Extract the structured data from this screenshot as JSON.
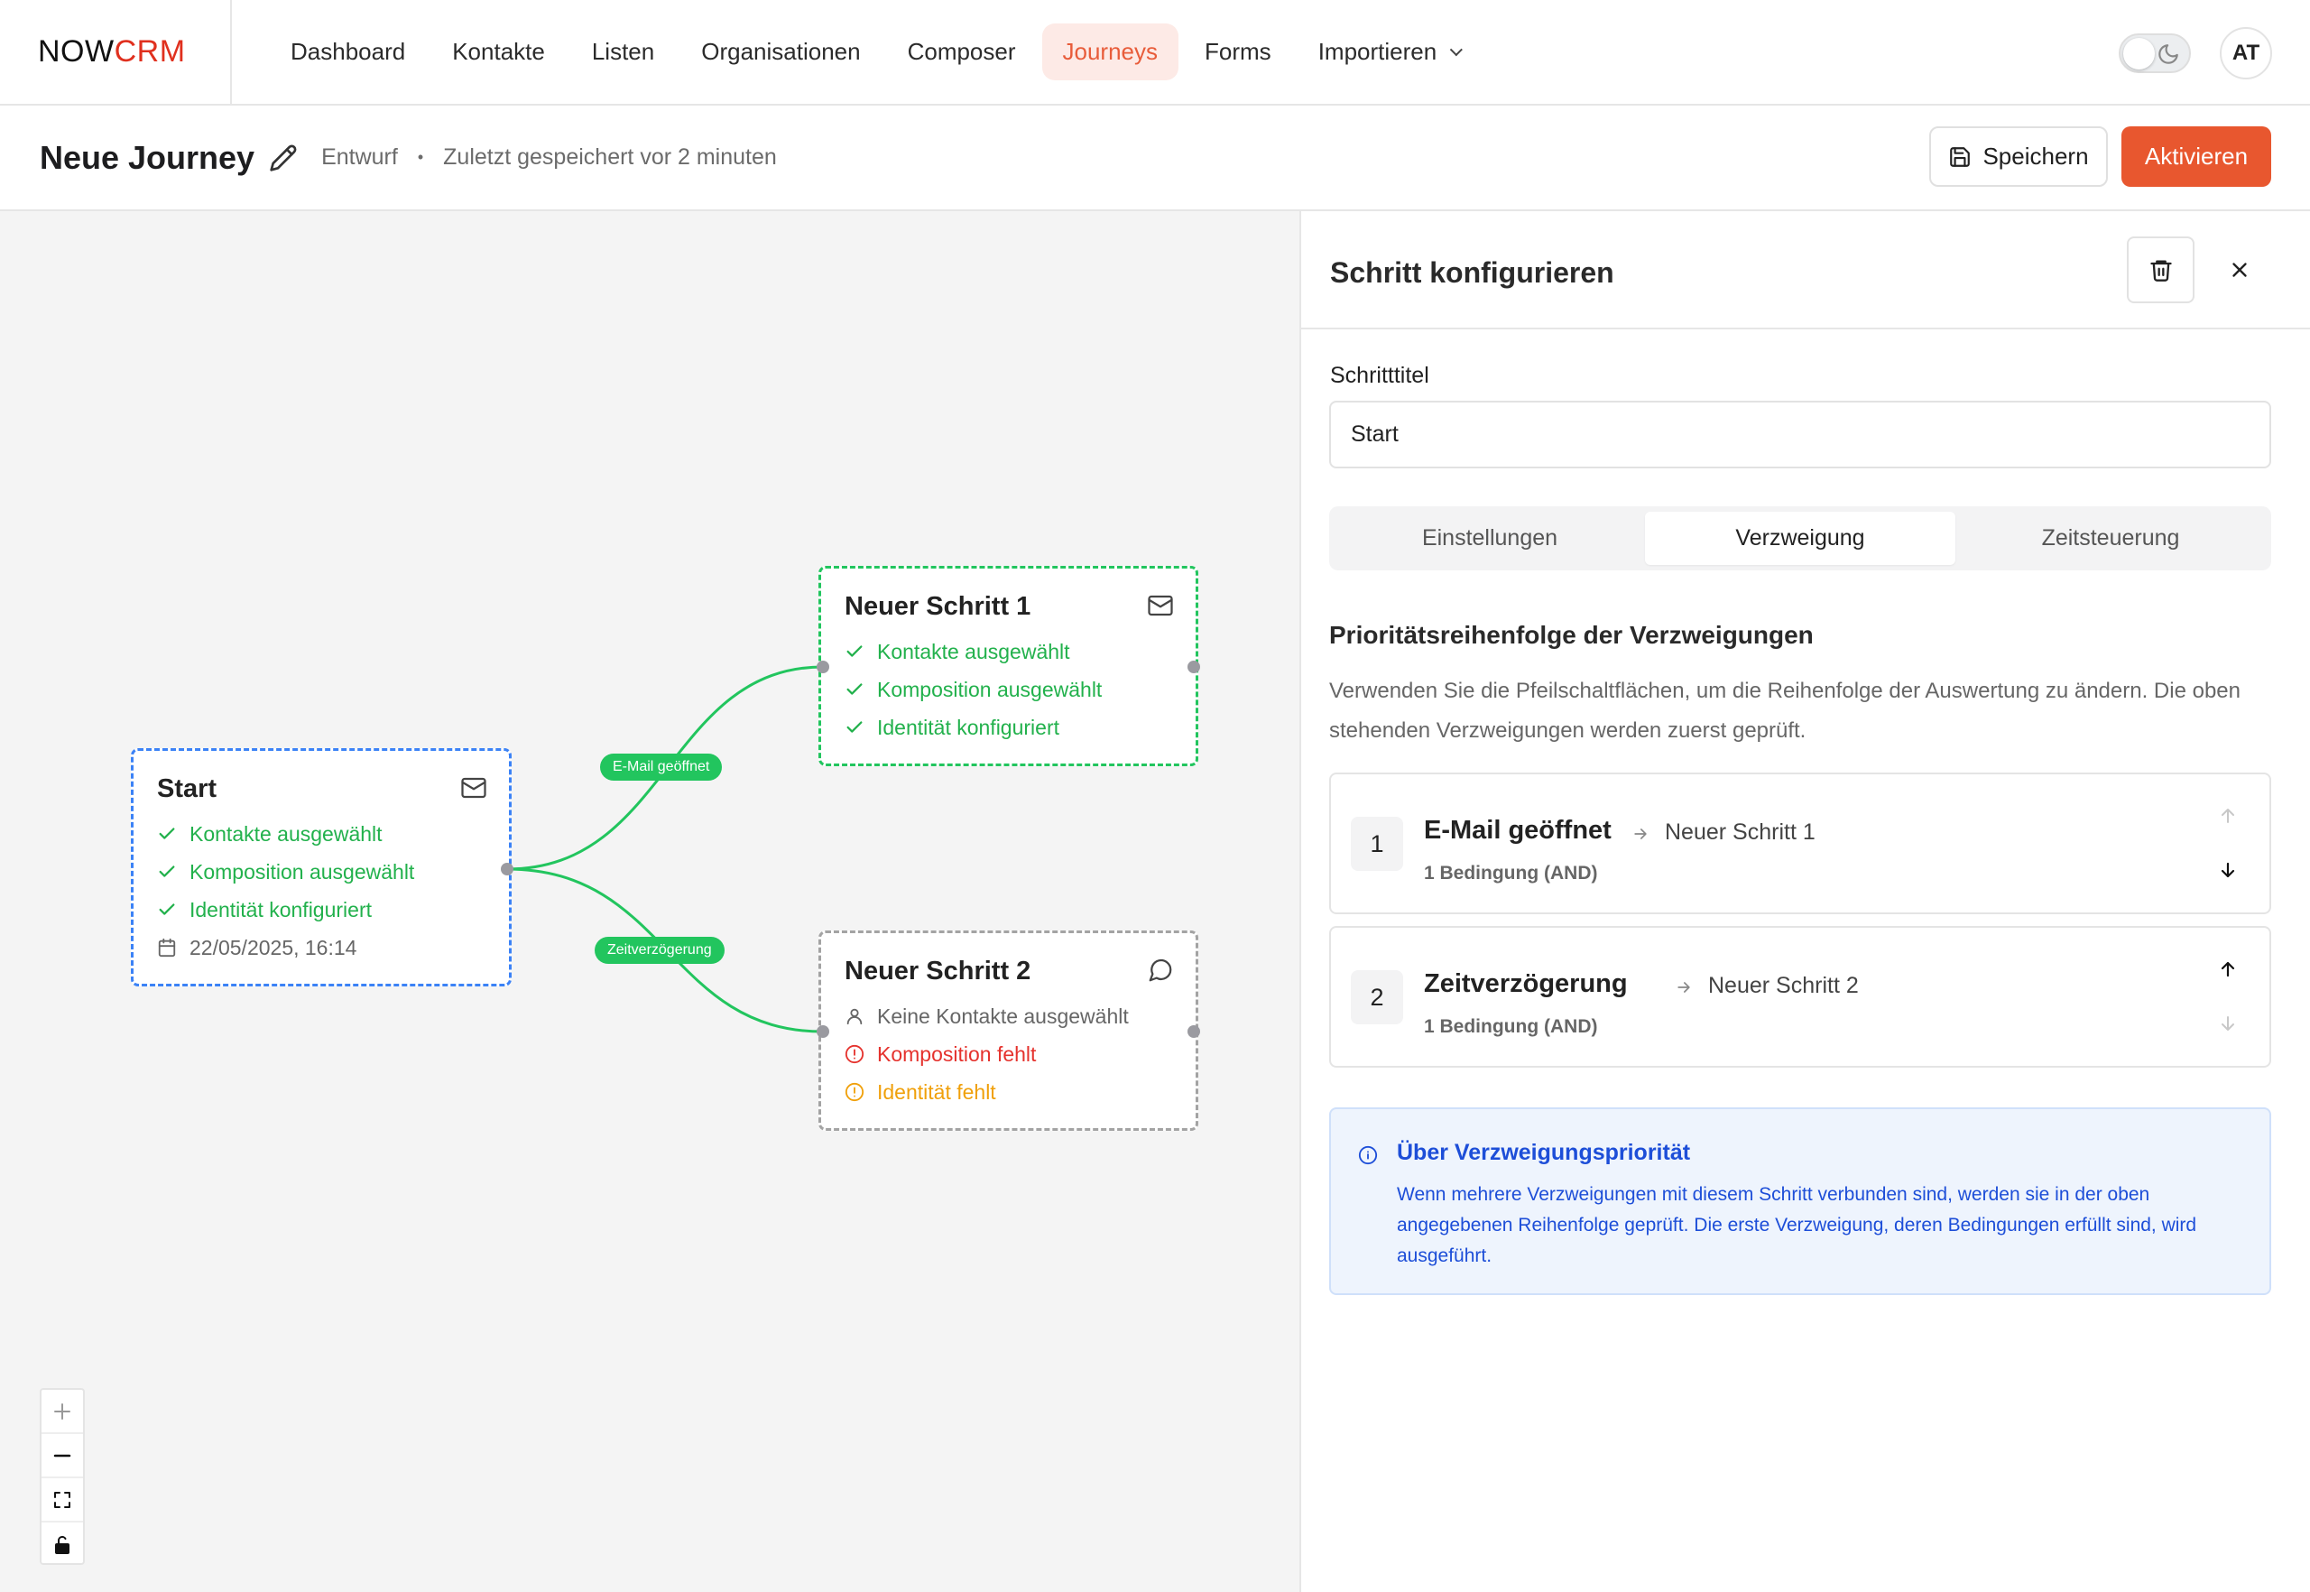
{
  "brand": {
    "part1": "NOW",
    "part2": "CRM"
  },
  "nav": {
    "items": [
      {
        "label": "Dashboard",
        "active": false
      },
      {
        "label": "Kontakte",
        "active": false
      },
      {
        "label": "Listen",
        "active": false
      },
      {
        "label": "Organisationen",
        "active": false
      },
      {
        "label": "Composer",
        "active": false
      },
      {
        "label": "Journeys",
        "active": true
      },
      {
        "label": "Forms",
        "active": false
      },
      {
        "label": "Importieren",
        "active": false,
        "has_dropdown": true
      }
    ],
    "avatar_initials": "AT"
  },
  "journey": {
    "title": "Neue Journey",
    "status": "Entwurf",
    "saved_info": "Zuletzt gespeichert vor 2 minuten",
    "save_label": "Speichern",
    "activate_label": "Aktivieren"
  },
  "canvas": {
    "nodes": {
      "start": {
        "title": "Start",
        "icon": "mail-icon",
        "lines": [
          "Kontakte ausgewählt",
          "Komposition ausgewählt",
          "Identität konfiguriert"
        ],
        "date": "22/05/2025, 16:14"
      },
      "step1": {
        "title": "Neuer Schritt 1",
        "icon": "mail-icon",
        "lines": [
          "Kontakte ausgewählt",
          "Komposition ausgewählt",
          "Identität konfiguriert"
        ]
      },
      "step2": {
        "title": "Neuer Schritt 2",
        "icon": "chat-bubble-icon",
        "lines": [
          "Keine Kontakte ausgewählt",
          "Komposition fehlt",
          "Identität fehlt"
        ]
      }
    },
    "edges": [
      {
        "label": "E-Mail geöffnet"
      },
      {
        "label": "Zeitverzögerung"
      }
    ]
  },
  "panel": {
    "title": "Schritt konfigurieren",
    "field_label": "Schritttitel",
    "field_value": "Start",
    "tabs": [
      {
        "label": "Einstellungen",
        "active": false
      },
      {
        "label": "Verzweigung",
        "active": true
      },
      {
        "label": "Zeitsteuerung",
        "active": false
      }
    ],
    "section_title": "Prioritätsreihenfolge der Verzweigungen",
    "section_desc": "Verwenden Sie die Pfeilschaltflächen, um die Reihenfolge der Auswertung zu ändern. Die oben stehenden Verzweigungen werden zuerst geprüft.",
    "branches": [
      {
        "num": "1",
        "name": "E-Mail geöffnet",
        "target": "Neuer Schritt 1",
        "conditions": "1 Bedingung (AND)"
      },
      {
        "num": "2",
        "name": "Zeitverzögerung",
        "target": "Neuer Schritt 2",
        "conditions": "1 Bedingung (AND)"
      }
    ],
    "info": {
      "title": "Über Verzweigungspriorität",
      "text": "Wenn mehrere Verzweigungen mit diesem Schritt verbunden sind, werden sie in der oben angegebenen Reihenfolge geprüft. Die erste Verzweigung, deren Bedingungen erfüllt sind, wird ausgeführt."
    }
  },
  "colors": {
    "accent": "#e8572f",
    "success": "#22c55e",
    "error": "#e5322d",
    "warning": "#f0a00a",
    "selected_border": "#3b82f6",
    "info_text": "#1d4ed8"
  }
}
